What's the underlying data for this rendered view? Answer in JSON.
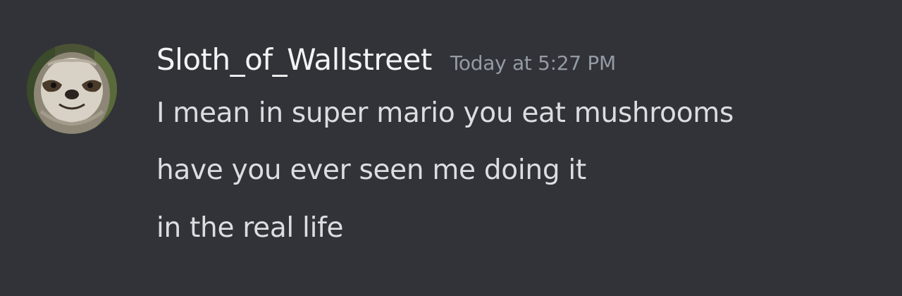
{
  "message": {
    "username": "Sloth_of_Wallstreet",
    "timestamp": "Today at 5:27 PM",
    "lines": [
      "I mean in super mario you eat mushrooms",
      "have you ever seen me doing it",
      "in the real life"
    ]
  },
  "icons": {
    "avatar": "sloth-avatar-icon"
  },
  "colors": {
    "background": "#313338",
    "username": "#f2f3f5",
    "timestamp": "#949ba4",
    "message_text": "#dbdee1"
  }
}
